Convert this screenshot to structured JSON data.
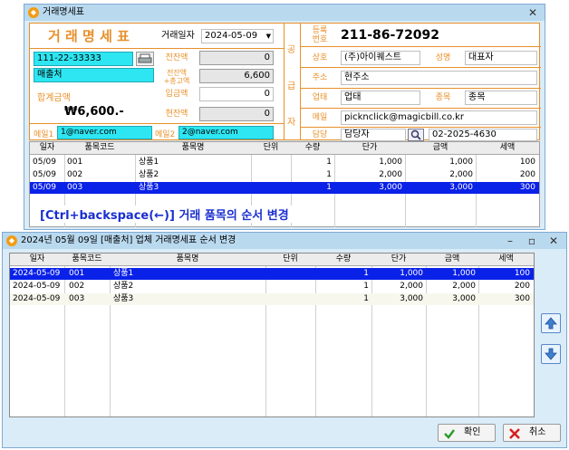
{
  "back_window": {
    "title": "거래명세표",
    "form": {
      "heading": "거 래 명 세 표",
      "trade_date_label": "거래일자",
      "trade_date": "2024-05-09",
      "customer_code": "111-22-33333",
      "customer_name": "매출처",
      "prev_balance_label": "전잔액",
      "prev_balance": "0",
      "total_balance_label_1": "전잔액",
      "total_balance_label_2": "+총고액",
      "total_balance": "6,600",
      "sum_label": "합계금액",
      "sum_value": "₩6,600.-",
      "deposit_label": "입금액",
      "deposit": "0",
      "current_balance_label": "현잔액",
      "current_balance": "0",
      "email1_label": "메일1",
      "email1": "1@naver.com",
      "email2_label": "메일2",
      "email2": "2@naver.com",
      "supplier_side_chars": [
        "공",
        "급",
        "자"
      ],
      "reg_no_label_1": "등록",
      "reg_no_label_2": "번호",
      "reg_no": "211-86-72092",
      "company_label": "상호",
      "company": "(주)아이퀘스트",
      "ceo_label": "성명",
      "ceo": "대표자",
      "address_label": "주소",
      "address": "현주소",
      "biz_type_label": "업태",
      "biz_type": "업태",
      "biz_item_label": "종목",
      "biz_item": "종목",
      "mail_label": "메일",
      "mail": "picknclick@magicbill.co.kr",
      "manager_label": "담당",
      "manager": "담당자",
      "phone": "02-2025-4630"
    },
    "grid": {
      "headers": [
        "일자",
        "품목코드",
        "품목명",
        "단위",
        "수량",
        "단가",
        "금액",
        "세액"
      ],
      "rows": [
        {
          "date": "05/09",
          "code": "001",
          "name": "상품1",
          "unit": "",
          "qty": "1",
          "price": "1,000",
          "amount": "1,000",
          "tax": "100",
          "selected": false
        },
        {
          "date": "05/09",
          "code": "002",
          "name": "상품2",
          "unit": "",
          "qty": "1",
          "price": "2,000",
          "amount": "2,000",
          "tax": "200",
          "selected": false
        },
        {
          "date": "05/09",
          "code": "003",
          "name": "상품3",
          "unit": "",
          "qty": "1",
          "price": "3,000",
          "amount": "3,000",
          "tax": "300",
          "selected": true
        }
      ]
    },
    "annotation": "[Ctrl+backspace(←)] 거래 품목의 순서 변경"
  },
  "dialog": {
    "title": "2024년 05월 09일 [매출처] 업체 거래명세표 순서 변경",
    "grid": {
      "headers": [
        "일자",
        "품목코드",
        "품목명",
        "단위",
        "수량",
        "단가",
        "금액",
        "세액"
      ],
      "rows": [
        {
          "date": "2024-05-09",
          "code": "001",
          "name": "상품1",
          "unit": "",
          "qty": "1",
          "price": "1,000",
          "amount": "1,000",
          "tax": "100",
          "selected": true
        },
        {
          "date": "2024-05-09",
          "code": "002",
          "name": "상품2",
          "unit": "",
          "qty": "1",
          "price": "2,000",
          "amount": "2,000",
          "tax": "200",
          "selected": false
        },
        {
          "date": "2024-05-09",
          "code": "003",
          "name": "상품3",
          "unit": "",
          "qty": "1",
          "price": "3,000",
          "amount": "3,000",
          "tax": "300",
          "selected": false
        }
      ]
    },
    "ok_label": "확인",
    "cancel_label": "취소"
  },
  "colors": {
    "accent_orange": "#e8902a",
    "selection_blue": "#0a21e8",
    "annotation_blue": "#1a2fd0",
    "cyan_field": "#2de6f2",
    "title_bar": "#b9d9ef"
  },
  "icons": [
    "app-icon",
    "close-icon",
    "print-icon",
    "search-icon",
    "arrow-up-icon",
    "arrow-down-icon",
    "check-icon",
    "cancel-x-icon",
    "minimize-icon",
    "maximize-icon"
  ]
}
